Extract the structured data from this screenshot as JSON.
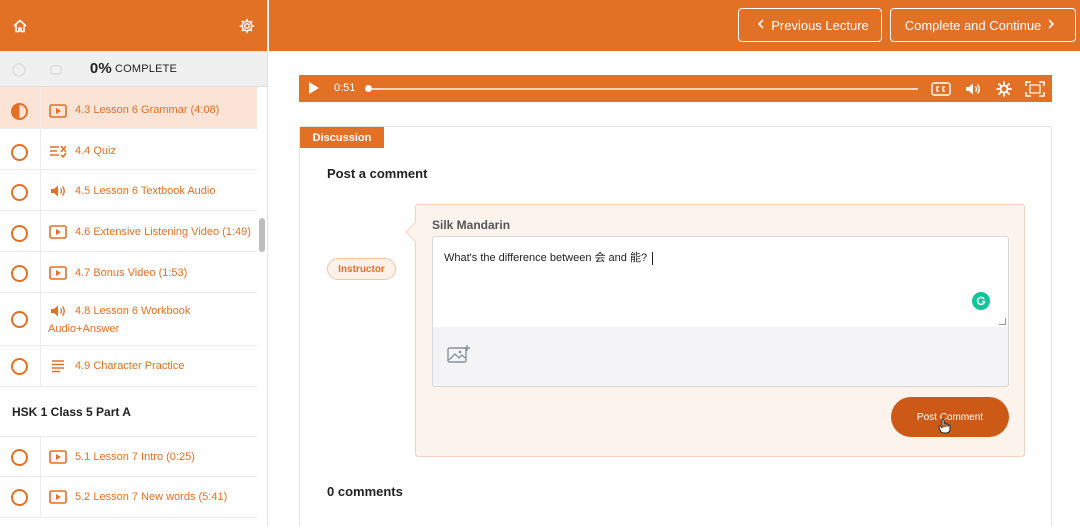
{
  "sidebar": {
    "progress_percent": "0%",
    "progress_label": "COMPLETE",
    "items": [
      {
        "label": "4.3 Lesson 6 Grammar (4:08)",
        "status": "in-progress",
        "type": "video"
      },
      {
        "label": "4.4 Quiz",
        "status": "incomplete",
        "type": "quiz"
      },
      {
        "label": "4.5 Lesson 6 Textbook Audio",
        "status": "incomplete",
        "type": "audio"
      },
      {
        "label": "4.6 Extensive Listening Video (1:49)",
        "status": "incomplete",
        "type": "video"
      },
      {
        "label": "4.7 Bonus Video (1:53)",
        "status": "incomplete",
        "type": "video"
      },
      {
        "label_line1": "4.8 Lesson 6 Workbook",
        "label_line2": "Audio+Answer",
        "status": "incomplete",
        "type": "audio"
      },
      {
        "label": "4.9 Character Practice",
        "status": "incomplete",
        "type": "text"
      }
    ],
    "section_title": "HSK 1 Class 5 Part A",
    "section_items": [
      {
        "label": "5.1 Lesson 7 Intro (0:25)",
        "status": "incomplete",
        "type": "video"
      },
      {
        "label": "5.2 Lesson 7 New words (5:41)",
        "status": "incomplete",
        "type": "video"
      }
    ]
  },
  "topbar": {
    "prev_label": "Previous Lecture",
    "next_label": "Complete and Continue"
  },
  "player": {
    "time": "0:51",
    "progress_fraction": 0.0
  },
  "discussion": {
    "tab_label": "Discussion",
    "post_title": "Post a comment",
    "role_badge": "Instructor",
    "author": "Silk Mandarin",
    "comment_text": "What's the difference between 会 and 能?",
    "post_button": "Post Comment",
    "comments_count": "0 comments"
  },
  "colors": {
    "brand": "#e27025",
    "active_row": "#fbe4d6",
    "post_button": "#cc5a16",
    "grammarly": "#15c39a"
  }
}
